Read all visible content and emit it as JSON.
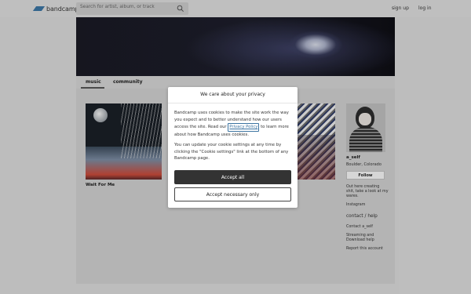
{
  "header": {
    "logo_text": "bandcamp",
    "search_placeholder": "Search for artist, album, or track",
    "signup_label": "sign up",
    "login_label": "log in"
  },
  "tabs": [
    {
      "label": "music",
      "selected": true
    },
    {
      "label": "community",
      "selected": false
    }
  ],
  "albums": [
    {
      "title": "Wait For Me"
    }
  ],
  "artist": {
    "name": "a_self",
    "location": "Boulder, Colorado",
    "follow_label": "Follow",
    "bio": "Out here creating shit, take a look at my wares.",
    "links": [
      "Instagram"
    ],
    "contact_heading": "contact / help",
    "contact_links": [
      "Contact a_self",
      "Streaming and Download help",
      "Report this account"
    ]
  },
  "modal": {
    "title": "We care about your privacy",
    "text1_before": "Bandcamp uses cookies to make the site work the way you expect and to better understand how our users access the site. Read our ",
    "privacy_link": "Privacy Policy",
    "text1_after": " to learn more about how Bandcamp uses cookies.",
    "text2": "You can update your cookie settings at any time by clicking the \"Cookie settings\" link at the bottom of any Bandcamp page.",
    "accept_all_label": "Accept all",
    "accept_necessary_label": "Accept necessary only"
  },
  "colors": {
    "brand": "#3b73a1",
    "button_dark": "#333333"
  }
}
